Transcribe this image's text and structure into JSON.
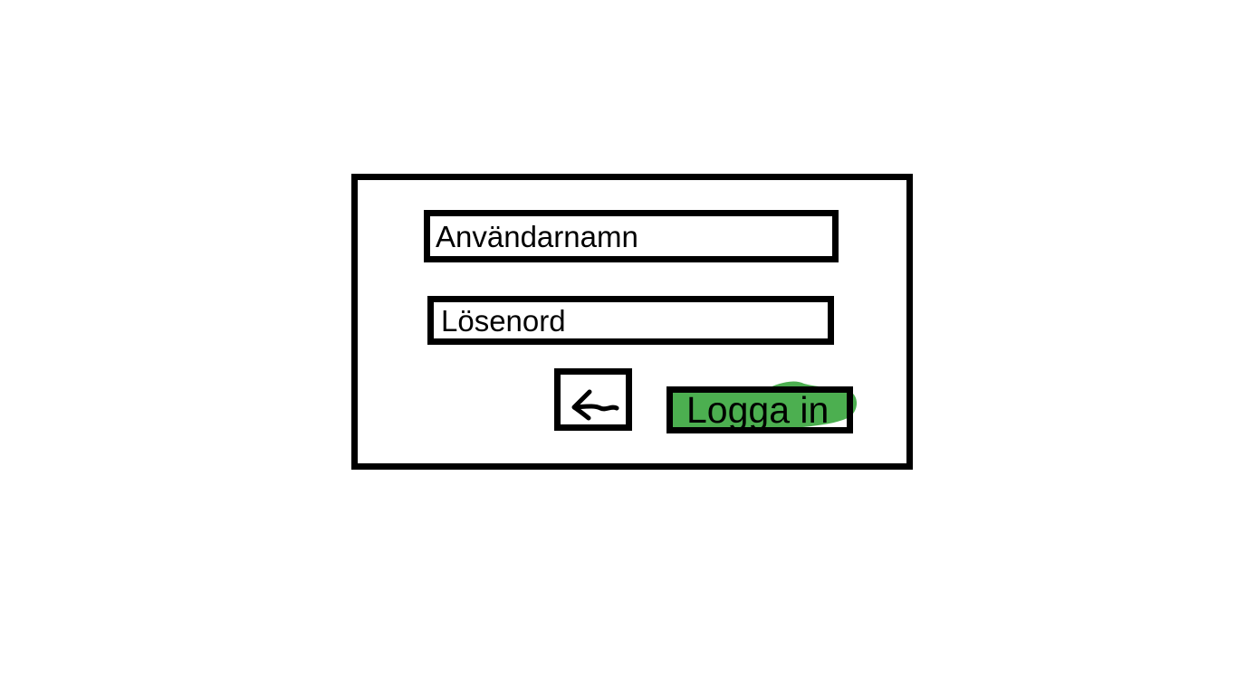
{
  "login_form": {
    "username_placeholder": "Användarnamn",
    "password_placeholder": "Lösenord",
    "login_button_label": "Logga in",
    "back_icon": "arrow-left-icon"
  },
  "colors": {
    "border": "#000000",
    "login_button_accent": "#4caf50",
    "background": "#ffffff"
  }
}
